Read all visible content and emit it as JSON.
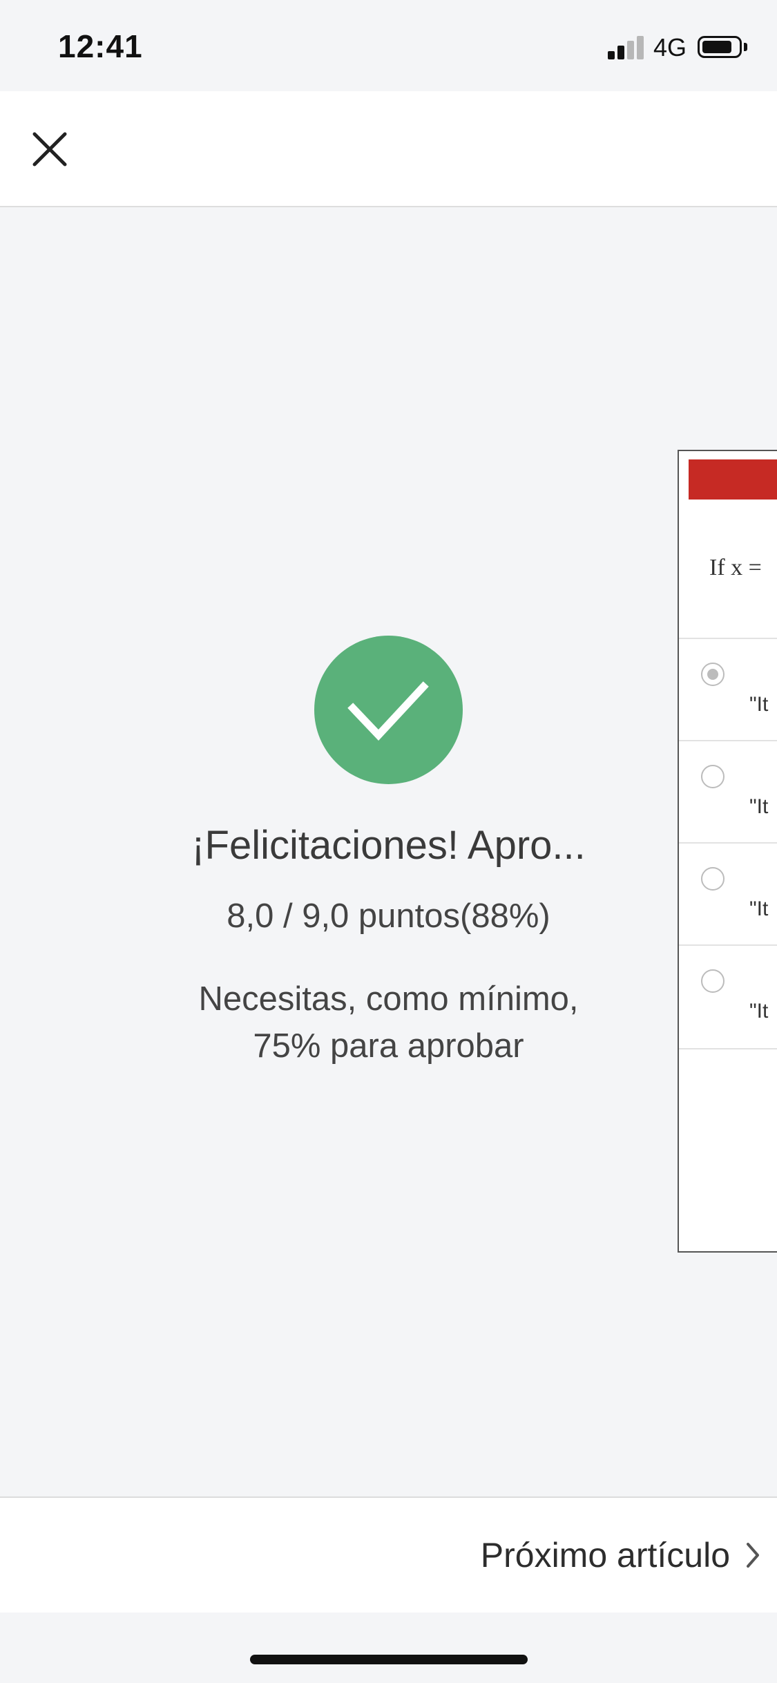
{
  "status_bar": {
    "time": "12:41",
    "network": "4G"
  },
  "header": {
    "close_icon": "close-icon"
  },
  "result": {
    "icon": "checkmark-icon",
    "title": "¡Felicitaciones! Apro...",
    "score": "8,0 / 9,0 puntos(88%)",
    "requirement_line1": "Necesitas, como mínimo,",
    "requirement_line2": "75% para aprobar",
    "success_color": "#5ab17a"
  },
  "peek_card": {
    "accent_color": "#c62a24",
    "question": "If x =",
    "options": [
      "\"It",
      "\"It",
      "\"It",
      "\"It"
    ],
    "selected_index": 0
  },
  "footer": {
    "next_label": "Próximo artículo",
    "next_icon": "chevron-right-icon"
  }
}
